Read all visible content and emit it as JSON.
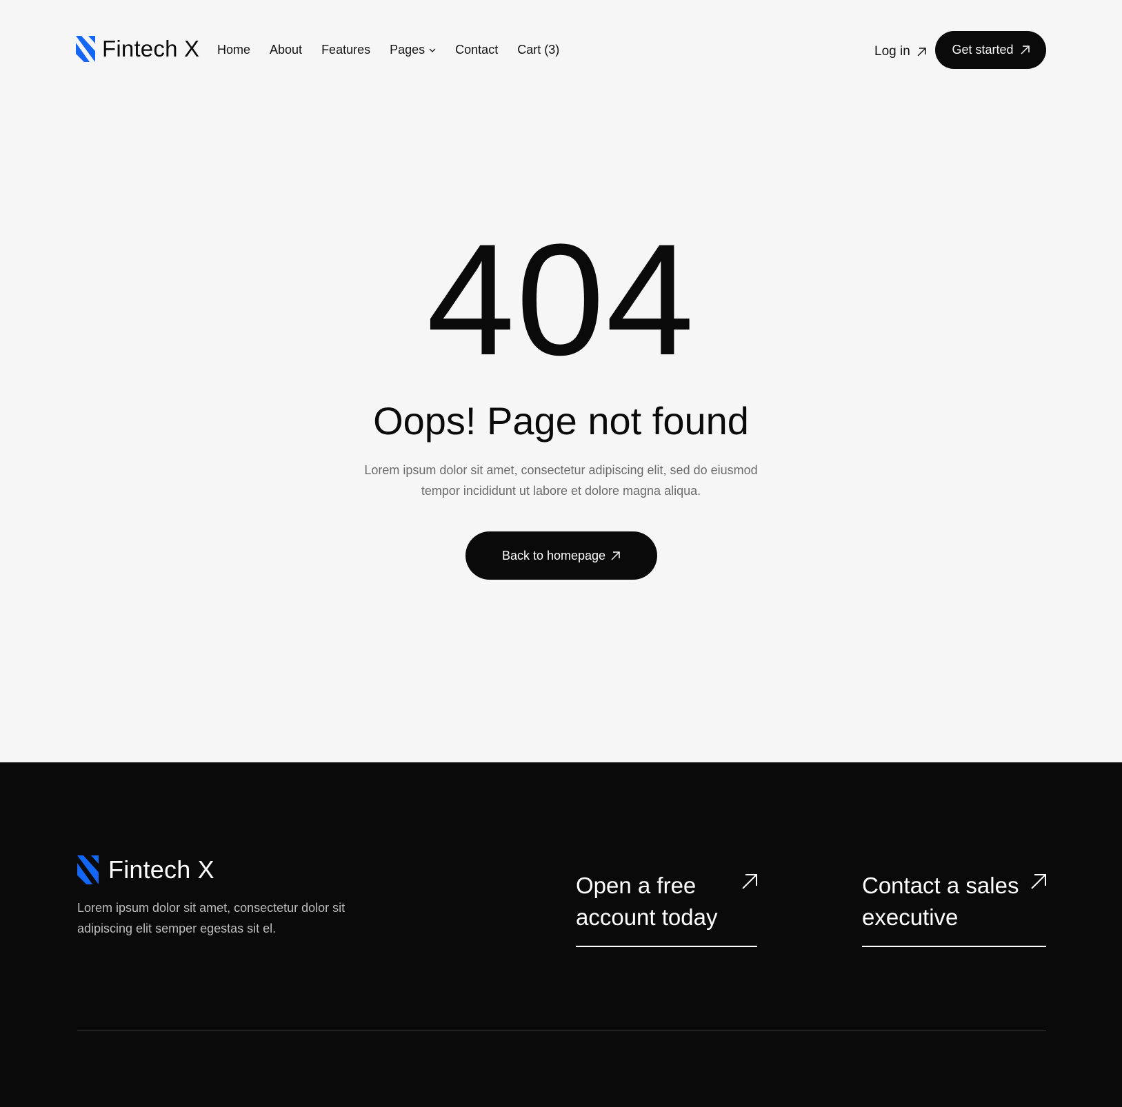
{
  "brand": {
    "name": "Fintech X",
    "accent": "#1467f5"
  },
  "nav": {
    "items": [
      {
        "label": "Home"
      },
      {
        "label": "About"
      },
      {
        "label": "Features"
      },
      {
        "label": "Pages",
        "dropdown": true
      },
      {
        "label": "Contact"
      },
      {
        "label": "Cart (3)"
      }
    ],
    "login_label": "Log in",
    "get_started_label": "Get started"
  },
  "hero": {
    "code": "404",
    "headline": "Oops! Page not found",
    "description": "Lorem ipsum dolor sit amet, consectetur adipiscing elit, sed do eiusmod tempor incididunt ut labore et dolore magna aliqua.",
    "button_label": "Back to homepage"
  },
  "footer": {
    "brand_name": "Fintech X",
    "description": "Lorem ipsum dolor sit amet, consectetur dolor sit adipiscing elit semper egestas sit el.",
    "cta_account": "Open a free account today",
    "cta_sales": "Contact a sales executive"
  }
}
